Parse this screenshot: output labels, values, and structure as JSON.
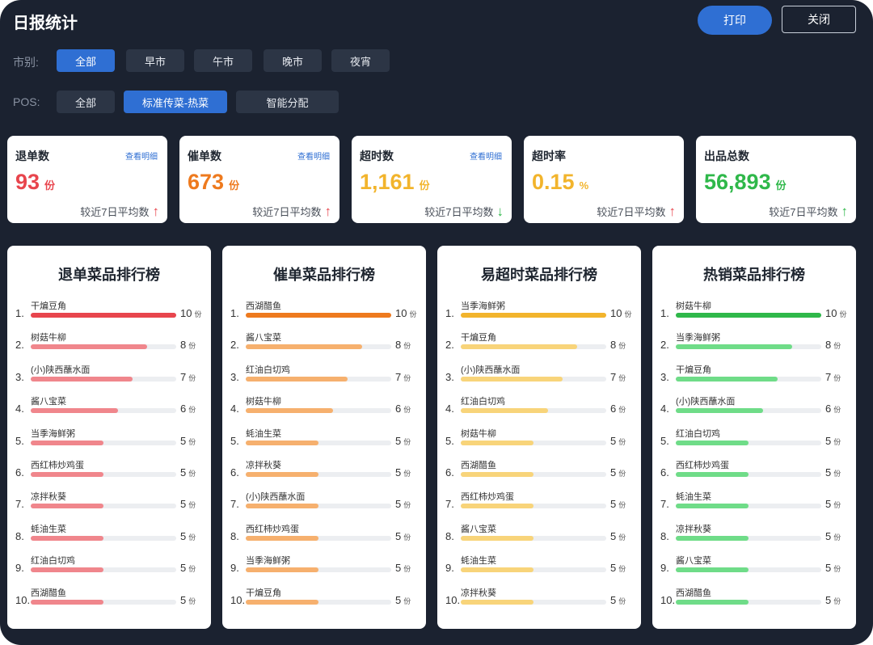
{
  "header": {
    "title": "日报统计",
    "print_label": "打印",
    "close_label": "关闭"
  },
  "filters": {
    "market": {
      "label": "市别:",
      "options": [
        "全部",
        "早市",
        "午市",
        "晚市",
        "夜宵"
      ],
      "selected": 0
    },
    "pos": {
      "label": "POS:",
      "options": [
        "全部",
        "标准传菜-热菜",
        "智能分配"
      ],
      "selected": 1
    }
  },
  "cards": [
    {
      "label": "退单数",
      "link": "查看明细",
      "value": "93",
      "unit": "份",
      "avg_text": "较近7日平均数",
      "trend": "up",
      "value_color": "#e8454d",
      "arrow_color": "#e8454d"
    },
    {
      "label": "催单数",
      "link": "查看明细",
      "value": "673",
      "unit": "份",
      "avg_text": "较近7日平均数",
      "trend": "up",
      "value_color": "#ee7a1e",
      "arrow_color": "#e8454d"
    },
    {
      "label": "超时数",
      "link": "查看明细",
      "value": "1,161",
      "unit": "份",
      "avg_text": "较近7日平均数",
      "trend": "down",
      "value_color": "#f2b42c",
      "arrow_color": "#2fb84a"
    },
    {
      "label": "超时率",
      "link": "",
      "value": "0.15",
      "unit": "%",
      "avg_text": "较近7日平均数",
      "trend": "up",
      "value_color": "#f2b42c",
      "arrow_color": "#e8454d"
    },
    {
      "label": "出品总数",
      "link": "",
      "value": "56,893",
      "unit": "份",
      "avg_text": "较近7日平均数",
      "trend": "up",
      "value_color": "#2fb84a",
      "arrow_color": "#2fb84a"
    }
  ],
  "rankings": [
    {
      "title": "退单菜品排行榜",
      "color_top": "#e8454d",
      "color": "#f0868c",
      "unit": "份",
      "items": [
        {
          "rank": "1.",
          "name": "干煸豆角",
          "count": 10
        },
        {
          "rank": "2.",
          "name": "树菇牛柳",
          "count": 8
        },
        {
          "rank": "3.",
          "name": "(小)陕西蘸水面",
          "count": 7
        },
        {
          "rank": "4.",
          "name": "酱八宝菜",
          "count": 6
        },
        {
          "rank": "5.",
          "name": "当季海鲜粥",
          "count": 5
        },
        {
          "rank": "6.",
          "name": "西红柿炒鸡蛋",
          "count": 5
        },
        {
          "rank": "7.",
          "name": "凉拌秋葵",
          "count": 5
        },
        {
          "rank": "8.",
          "name": "蚝油生菜",
          "count": 5
        },
        {
          "rank": "9.",
          "name": "红油白切鸡",
          "count": 5
        },
        {
          "rank": "10.",
          "name": "西湖醋鱼",
          "count": 5
        }
      ]
    },
    {
      "title": "催单菜品排行榜",
      "color_top": "#ee7a1e",
      "color": "#f6b06e",
      "unit": "份",
      "items": [
        {
          "rank": "1.",
          "name": "西湖醋鱼",
          "count": 10
        },
        {
          "rank": "2.",
          "name": "酱八宝菜",
          "count": 8
        },
        {
          "rank": "3.",
          "name": "红油白切鸡",
          "count": 7
        },
        {
          "rank": "4.",
          "name": "树菇牛柳",
          "count": 6
        },
        {
          "rank": "5.",
          "name": "蚝油生菜",
          "count": 5
        },
        {
          "rank": "6.",
          "name": "凉拌秋葵",
          "count": 5
        },
        {
          "rank": "7.",
          "name": "(小)陕西蘸水面",
          "count": 5
        },
        {
          "rank": "8.",
          "name": "西红柿炒鸡蛋",
          "count": 5
        },
        {
          "rank": "9.",
          "name": "当季海鲜粥",
          "count": 5
        },
        {
          "rank": "10.",
          "name": "干煸豆角",
          "count": 5
        }
      ]
    },
    {
      "title": "易超时菜品排行榜",
      "color_top": "#f2b42c",
      "color": "#f8d47a",
      "unit": "份",
      "items": [
        {
          "rank": "1.",
          "name": "当季海鲜粥",
          "count": 10
        },
        {
          "rank": "2.",
          "name": "干煸豆角",
          "count": 8
        },
        {
          "rank": "3.",
          "name": "(小)陕西蘸水面",
          "count": 7
        },
        {
          "rank": "4.",
          "name": "红油白切鸡",
          "count": 6
        },
        {
          "rank": "5.",
          "name": "树菇牛柳",
          "count": 5
        },
        {
          "rank": "6.",
          "name": "西湖醋鱼",
          "count": 5
        },
        {
          "rank": "7.",
          "name": "西红柿炒鸡蛋",
          "count": 5
        },
        {
          "rank": "8.",
          "name": "酱八宝菜",
          "count": 5
        },
        {
          "rank": "9.",
          "name": "蚝油生菜",
          "count": 5
        },
        {
          "rank": "10.",
          "name": "凉拌秋葵",
          "count": 5
        }
      ]
    },
    {
      "title": "热销菜品排行榜",
      "color_top": "#2fb84a",
      "color": "#6fdc88",
      "unit": "份",
      "items": [
        {
          "rank": "1.",
          "name": "树菇牛柳",
          "count": 10
        },
        {
          "rank": "2.",
          "name": "当季海鲜粥",
          "count": 8
        },
        {
          "rank": "3.",
          "name": "干煸豆角",
          "count": 7
        },
        {
          "rank": "4.",
          "name": "(小)陕西蘸水面",
          "count": 6
        },
        {
          "rank": "5.",
          "name": "红油白切鸡",
          "count": 5
        },
        {
          "rank": "6.",
          "name": "西红柿炒鸡蛋",
          "count": 5
        },
        {
          "rank": "7.",
          "name": "蚝油生菜",
          "count": 5
        },
        {
          "rank": "8.",
          "name": "凉拌秋葵",
          "count": 5
        },
        {
          "rank": "9.",
          "name": "酱八宝菜",
          "count": 5
        },
        {
          "rank": "10.",
          "name": "西湖醋鱼",
          "count": 5
        }
      ]
    }
  ]
}
